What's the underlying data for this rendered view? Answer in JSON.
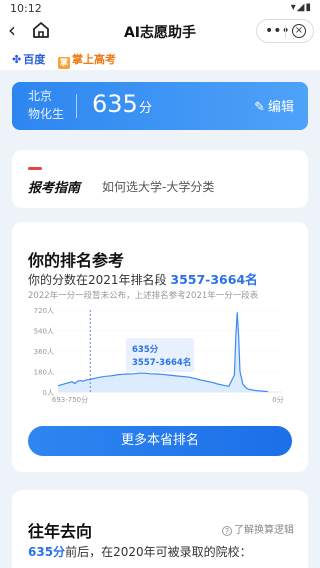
{
  "status_bar": {
    "time": "10:12",
    "icons": "▾◢▮"
  },
  "nav": {
    "back_glyph": "‹",
    "title": "AI志愿助手",
    "more_glyph": "•••",
    "close_glyph": "×"
  },
  "brands": {
    "baidu": "百度",
    "zsgk": "掌上高考",
    "zsgk_logo": "掌"
  },
  "score": {
    "region": "北京",
    "subjects": "物化生",
    "value": "635",
    "unit": "分",
    "edit_label": "编辑",
    "edit_icon": "✎"
  },
  "guide": {
    "title": "报考指南",
    "desc": "如何选大学-大学分类"
  },
  "rank": {
    "title": "你的排名参考",
    "line_prefix": "你的分数在2021年排名段",
    "line_range": "3557-3664名",
    "note": "2022年一分一段暂未公布，上述排名参考2021年一分一段表",
    "button_label": "更多本省排名"
  },
  "past": {
    "title": "往年去向",
    "help_label": "了解换算逻辑",
    "help_icon": "?",
    "line_score": "635分",
    "line_text": "前后，在2020年可被录取的院校："
  },
  "colors": {
    "accent": "#2a72e8",
    "card_gradient_start": "#2d86f0",
    "chart_line": "#3d8af5"
  },
  "chart_data": {
    "type": "area",
    "y_ticks": [
      "720人",
      "540人",
      "360人",
      "180人",
      "0人"
    ],
    "ylim": [
      0,
      720
    ],
    "x_start_label": "693-750分",
    "x_end_label": "0分",
    "x_range": [
      750,
      0
    ],
    "marker_score_label": "635分",
    "marker_rank_label": "3557-3664名",
    "grid": true,
    "series": [
      {
        "x": [
          750,
          700,
          690,
          680,
          670,
          660,
          650,
          640,
          635,
          620,
          600,
          580,
          560,
          540,
          520,
          500,
          480,
          460,
          440,
          420,
          400,
          380,
          360,
          340,
          320,
          300,
          280,
          260,
          240,
          220,
          200,
          180,
          160,
          140,
          120,
          115,
          110,
          105,
          100,
          90,
          80,
          70,
          60,
          50,
          40,
          30,
          20,
          10,
          0
        ],
        "y": [
          55,
          90,
          75,
          95,
          100,
          95,
          105,
          108,
          110,
          120,
          130,
          138,
          142,
          150,
          155,
          158,
          160,
          165,
          165,
          160,
          158,
          155,
          150,
          145,
          140,
          135,
          130,
          118,
          105,
          95,
          85,
          70,
          60,
          50,
          150,
          480,
          700,
          500,
          180,
          70,
          40,
          25,
          20,
          15,
          12,
          10,
          8,
          5,
          3
        ]
      }
    ]
  }
}
